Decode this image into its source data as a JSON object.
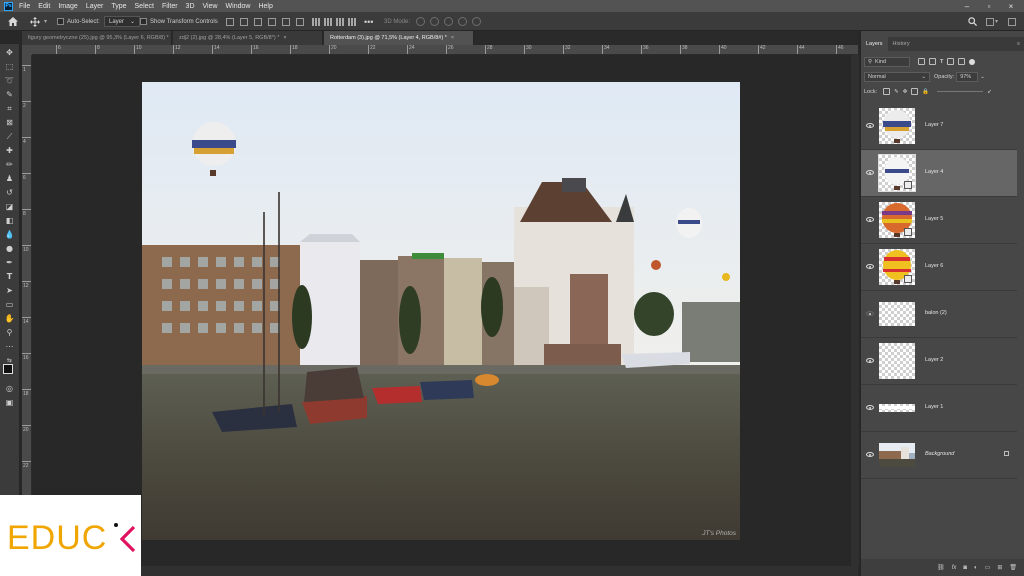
{
  "menu": {
    "items": [
      "File",
      "Edit",
      "Image",
      "Layer",
      "Type",
      "Select",
      "Filter",
      "3D",
      "View",
      "Window",
      "Help"
    ]
  },
  "options": {
    "auto_select_label": "Auto-Select:",
    "auto_select_value": "Layer",
    "transform_label": "Show Transform Controls",
    "mode_3d_label": "3D Mode:"
  },
  "tabs": [
    {
      "label": "figury geometryczne (25).jpg @ 95,3% (Layer 6, RGB/8) *",
      "close": "×"
    },
    {
      "label": "zdj2 (2).jpg @ 28,4% (Layer 5, RGB/8*) *",
      "close": "×"
    },
    {
      "label": "Rotterdam (3).jpg @ 71,5% (Layer 4, RGB/8#) *",
      "close": "×"
    }
  ],
  "ruler": {
    "top_labels": [
      "6",
      "8",
      "10",
      "12",
      "14",
      "16",
      "18",
      "20",
      "22",
      "24",
      "26",
      "28",
      "30",
      "32",
      "34",
      "36",
      "38",
      "40",
      "42",
      "44",
      "46"
    ],
    "left_labels": [
      "1",
      "2",
      "4",
      "6",
      "8",
      "10",
      "12",
      "14",
      "16",
      "18",
      "20",
      "22",
      "24"
    ]
  },
  "document": {
    "watermark": "JT's Photos"
  },
  "layers_panel": {
    "tab_layers": "Layers",
    "tab_history": "History",
    "filter_value": "Kind",
    "blend_mode": "Normal",
    "opacity_label": "Opacity:",
    "opacity_value": "97%",
    "lock_label": "Lock:",
    "layers": [
      {
        "name": "Layer 7",
        "kind": "balloon-stripes",
        "smart": false
      },
      {
        "name": "Layer 4",
        "kind": "balloon-white",
        "smart": true,
        "selected": true
      },
      {
        "name": "Layer 5",
        "kind": "balloon-orange",
        "smart": true
      },
      {
        "name": "Layer 6",
        "kind": "balloon-yellow",
        "smart": true
      },
      {
        "name": "balon (2)",
        "kind": "transparent",
        "hidden": true
      },
      {
        "name": "Layer 2",
        "kind": "transparent"
      },
      {
        "name": "Layer 1",
        "kind": "line"
      },
      {
        "name": "Background",
        "kind": "photo",
        "locked": true
      }
    ]
  },
  "brand": {
    "text": "EDUC",
    "accent": "#f0a500",
    "mark_color": "#e0115f"
  },
  "colors": {
    "accent": "#31a8ff",
    "panel": "#474747",
    "ui": "#3b3b3b"
  }
}
